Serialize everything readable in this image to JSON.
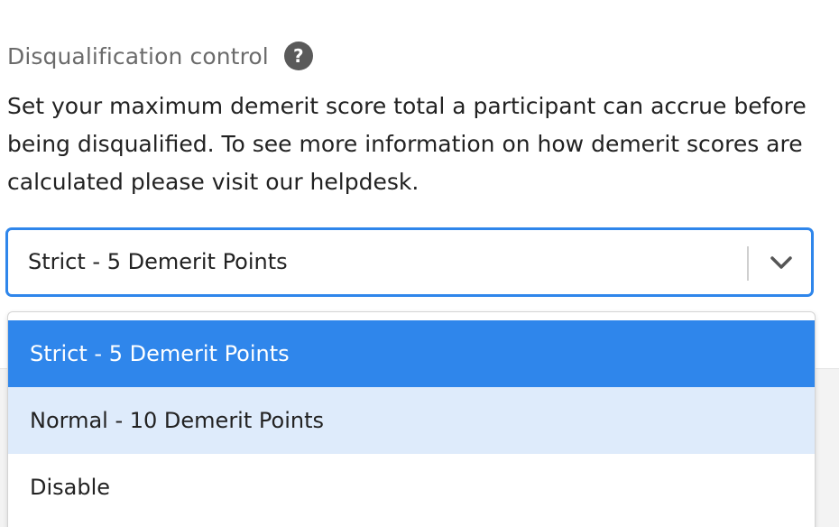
{
  "section": {
    "label": "Disqualification control",
    "help_icon": "question-mark-icon",
    "description": "Set your maximum demerit score total a participant can accrue before being disqualified. To see more information on how demerit scores are calculated please visit our helpdesk."
  },
  "select": {
    "value": "Strict - 5 Demerit Points",
    "indicator_icon": "chevron-down-icon",
    "options": [
      {
        "label": "Strict - 5 Demerit Points",
        "state": "selected"
      },
      {
        "label": "Normal - 10 Demerit Points",
        "state": "hovered"
      },
      {
        "label": "Disable",
        "state": "default"
      }
    ]
  },
  "colors": {
    "accent": "#2f86eb",
    "hover": "#deebfb",
    "label_text": "#6b6b6b",
    "help_icon_bg": "#5a5a5a"
  }
}
